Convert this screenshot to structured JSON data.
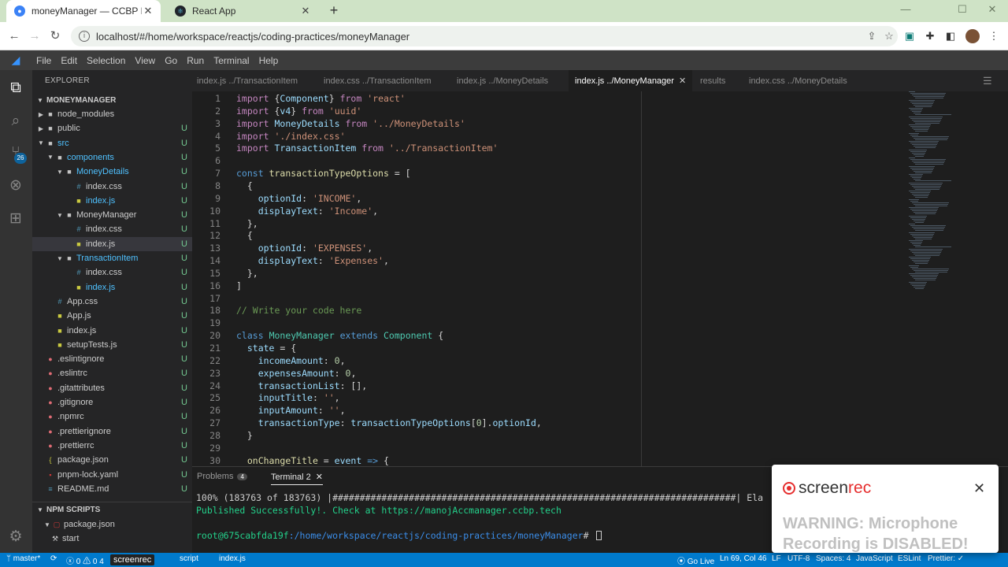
{
  "browser": {
    "tabs": [
      {
        "title": "moneyManager — CCBP IDE",
        "active": true
      },
      {
        "title": "React App",
        "active": false
      }
    ],
    "url": "localhost/#/home/workspace/reactjs/coding-practices/moneyManager"
  },
  "menu": [
    "File",
    "Edit",
    "Selection",
    "View",
    "Go",
    "Run",
    "Terminal",
    "Help"
  ],
  "activity": {
    "scm_badge": "26"
  },
  "explorer": {
    "title": "EXPLORER",
    "section": "MONEYMANAGER",
    "items": [
      {
        "label": "node_modules",
        "git": ""
      },
      {
        "label": "public",
        "git": "U"
      },
      {
        "label": "src",
        "git": "U"
      },
      {
        "label": "components",
        "git": "U"
      },
      {
        "label": "MoneyDetails",
        "git": "U"
      },
      {
        "label": "index.css",
        "git": "U"
      },
      {
        "label": "index.js",
        "git": "U"
      },
      {
        "label": "MoneyManager",
        "git": "U"
      },
      {
        "label": "index.css",
        "git": "U"
      },
      {
        "label": "index.js",
        "git": "U"
      },
      {
        "label": "TransactionItem",
        "git": "U"
      },
      {
        "label": "index.css",
        "git": "U"
      },
      {
        "label": "index.js",
        "git": "U"
      },
      {
        "label": "App.css",
        "git": "U"
      },
      {
        "label": "App.js",
        "git": "U"
      },
      {
        "label": "index.js",
        "git": "U"
      },
      {
        "label": "setupTests.js",
        "git": "U"
      },
      {
        "label": ".eslintignore",
        "git": "U"
      },
      {
        "label": ".eslintrc",
        "git": "U"
      },
      {
        "label": ".gitattributes",
        "git": "U"
      },
      {
        "label": ".gitignore",
        "git": "U"
      },
      {
        "label": ".npmrc",
        "git": "U"
      },
      {
        "label": ".prettierignore",
        "git": "U"
      },
      {
        "label": ".prettierrc",
        "git": "U"
      },
      {
        "label": "package.json",
        "git": "U"
      },
      {
        "label": "pnpm-lock.yaml",
        "git": "U"
      },
      {
        "label": "README.md",
        "git": "U"
      }
    ],
    "npm_section": "NPM SCRIPTS",
    "npm_items": [
      {
        "label": "package.json"
      },
      {
        "label": "start"
      }
    ]
  },
  "editor_tabs": [
    {
      "label": "index.js ../TransactionItem"
    },
    {
      "label": "index.css ../TransactionItem"
    },
    {
      "label": "index.js ../MoneyDetails"
    },
    {
      "label": "index.js ../MoneyManager"
    },
    {
      "label": "results"
    },
    {
      "label": "index.css ../MoneyDetails"
    }
  ],
  "code": {
    "line_numbers": [
      "1",
      "2",
      "3",
      "4",
      "5",
      "6",
      "7",
      "8",
      "9",
      "10",
      "11",
      "12",
      "13",
      "14",
      "15",
      "16",
      "17",
      "18",
      "19",
      "20",
      "21",
      "22",
      "23",
      "24",
      "25",
      "26",
      "27",
      "28",
      "29",
      "30"
    ]
  },
  "panel": {
    "tabs": [
      {
        "label": "Problems",
        "count": "4"
      },
      {
        "label": "Terminal 2"
      }
    ],
    "terminal": {
      "progress": "100% (183763 of 183763) |##########################################################################| Ela",
      "published": "Published Successfully!. Check at https://manojAccmanager.ccbp.tech",
      "prompt_user": "root@675cabfda19f",
      "prompt_path": ":/home/workspace/reactjs/coding-practices/moneyManager",
      "prompt_end": "# "
    }
  },
  "statusbar": {
    "branch": "master*",
    "errors": "0",
    "warnings": "0",
    "warnings_extra": "4",
    "lang_hint": "script",
    "file": "index.js",
    "go_live": "Go Live",
    "position": "Ln 69, Col 46",
    "eol": "LF",
    "encoding": "UTF-8",
    "spaces": "Spaces: 4",
    "language": "JavaScript",
    "eslint": "ESLint",
    "prettier": "Prettier: ✓"
  },
  "screenrec": {
    "badge": "screenrec",
    "brand_a": "screen",
    "brand_b": "rec",
    "warning": "WARNING: Microphone Recording is DISABLED!"
  },
  "colors": {
    "accent": "#007acc",
    "popup_red": "#e62e2e"
  }
}
